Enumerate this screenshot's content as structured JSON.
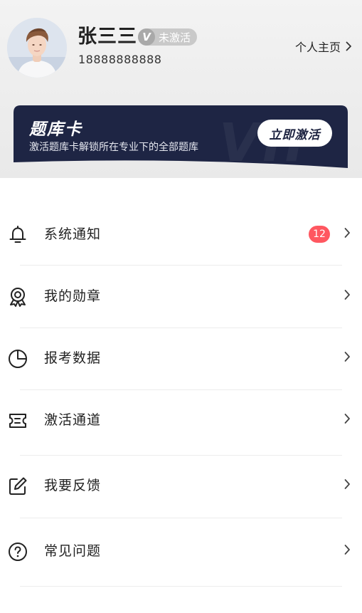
{
  "profile": {
    "name": "张三三",
    "status_v": "V",
    "status": "未激活",
    "phone": "18888888888",
    "homepage_label": "个人主页"
  },
  "vip_card": {
    "title": "题库卡",
    "description": "激活题库卡解锁所在专业下的全部题库",
    "button_label": "立即激活",
    "watermark": "VIP"
  },
  "menu": {
    "items": [
      {
        "label": "系统通知",
        "icon": "bell-icon",
        "badge": "12"
      },
      {
        "label": "我的勋章",
        "icon": "medal-icon"
      },
      {
        "label": "报考数据",
        "icon": "pie-chart-icon"
      },
      {
        "label": "激活通道",
        "icon": "ticket-icon"
      },
      {
        "label": "我要反馈",
        "icon": "edit-icon"
      },
      {
        "label": "常见问题",
        "icon": "question-icon"
      }
    ]
  },
  "colors": {
    "card_bg": "#1e2544",
    "badge_red": "#ff5760"
  }
}
